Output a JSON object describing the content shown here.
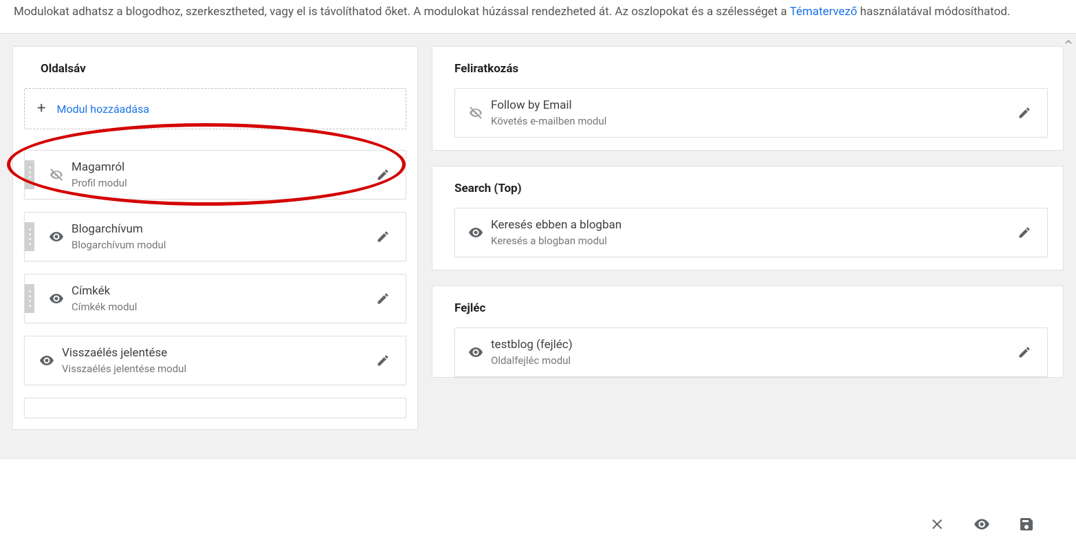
{
  "intro": {
    "text_before_link": "Modulokat adhatsz a blogodhoz, szerkesztheted, vagy el is távolíthatod őket. A modulokat húzással rendezheted át. Az oszlopokat és a szélességet a ",
    "link_text": "Tématervező",
    "text_after_link": " használatával módosíthatod."
  },
  "left": {
    "title": "Oldalsáv",
    "add_label": "Modul hozzáadása",
    "widgets": [
      {
        "title": "Magamról",
        "subtitle": "Profil modul",
        "visible": false,
        "has_handle": true
      },
      {
        "title": "Blogarchívum",
        "subtitle": "Blogarchívum modul",
        "visible": true,
        "has_handle": true
      },
      {
        "title": "Címkék",
        "subtitle": "Címkék modul",
        "visible": true,
        "has_handle": true
      },
      {
        "title": "Visszaélés jelentése",
        "subtitle": "Visszaélés jelentése modul",
        "visible": true,
        "has_handle": false
      }
    ]
  },
  "right": [
    {
      "title": "Feliratkozás",
      "widgets": [
        {
          "title": "Follow by Email",
          "subtitle": "Követés e-mailben modul",
          "visible": false
        }
      ]
    },
    {
      "title": "Search (Top)",
      "widgets": [
        {
          "title": "Keresés ebben a blogban",
          "subtitle": "Keresés a blogban modul",
          "visible": true
        }
      ]
    },
    {
      "title": "Fejléc",
      "widgets": [
        {
          "title": "testblog (fejléc)",
          "subtitle": "Oldalfejléc modul",
          "visible": true
        }
      ]
    }
  ]
}
